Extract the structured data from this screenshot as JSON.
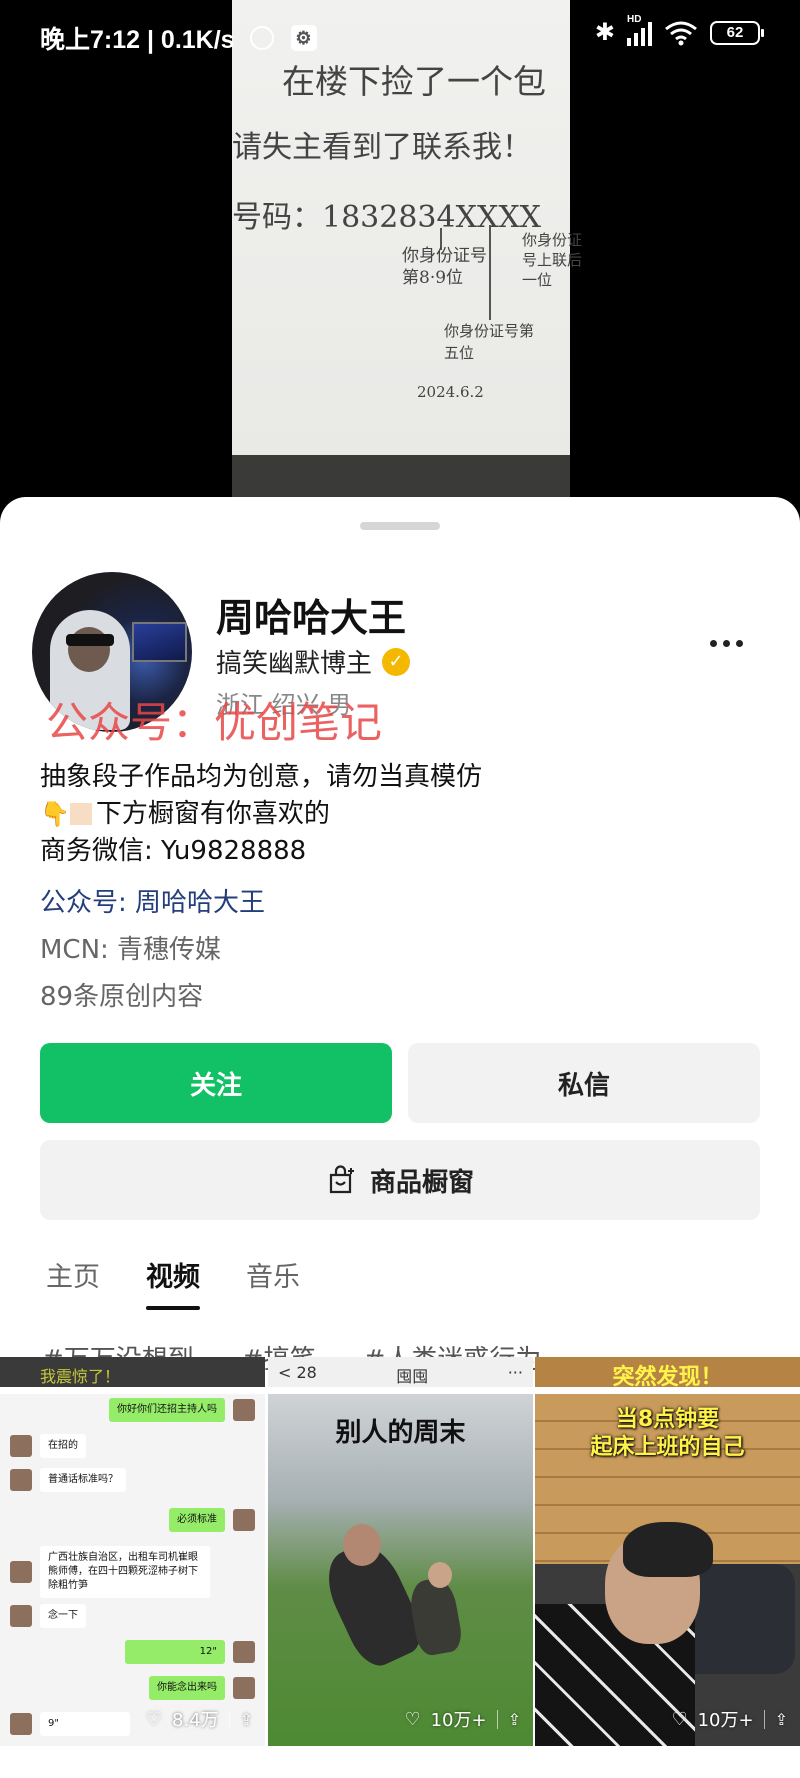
{
  "status_bar": {
    "time": "晚上7:12 | 0.1K/s",
    "hd": "HD",
    "battery": "62"
  },
  "video_note": {
    "line1": "在楼下捡了一个包",
    "line2": "请失主看到了联系我！",
    "line3": "号码：1832834XXXX",
    "note_id_digits": "你身份证号第8·9位",
    "note_id_tail": "你身份证号上联后一位",
    "note_id_fifth": "你身份证号第五位",
    "date": "2024.6.2"
  },
  "profile": {
    "name": "周哈哈大王",
    "tag": "搞笑幽默博主",
    "location": "浙江 绍兴 男",
    "watermark": "公众号：优创笔记",
    "bio_line1": "抽象段子作品均为创意，请勿当真模仿",
    "bio_line2": "下方橱窗有你喜欢的",
    "bio_line3": "商务微信: Yu9828888",
    "official_account": "公众号: 周哈哈大王",
    "mcn": "MCN: 青穗传媒",
    "count": "89条原创内容"
  },
  "actions": {
    "follow": "关注",
    "message": "私信",
    "shop": "商品橱窗"
  },
  "tabs": [
    {
      "label": "主页",
      "active": false
    },
    {
      "label": "视频",
      "active": true
    },
    {
      "label": "音乐",
      "active": false
    }
  ],
  "hashtags": [
    "#万万没想到",
    "#搞笑",
    "#人类迷惑行为"
  ],
  "videos": [
    {
      "likes": "8.4万",
      "chat": {
        "m1": "你好你们还招主持人吗",
        "m2": "在招的",
        "m3": "普通话标准吗？",
        "m4": "必须标准",
        "m5": "广西壮族自治区，出租车司机崔眼熊师傅，在四十四颗死涩柿子树下除粗竹笋",
        "m6": "念一下",
        "m7": "12\"",
        "m8": "你能念出来吗",
        "m9": "9\""
      }
    },
    {
      "title": "别人的周末",
      "likes": "10万+"
    },
    {
      "title_line1": "当8点钟要",
      "title_line2": "起床上班的自己",
      "likes": "10万+"
    }
  ],
  "peek_row": {
    "left": "我震惊了！",
    "mid_left": "< 28",
    "mid_center": "囤囤",
    "mid_right": "···",
    "right": "突然发现！"
  },
  "colors": {
    "follow_green": "#12c065",
    "link_blue": "#233e7a",
    "verify_gold": "#f4b800"
  }
}
